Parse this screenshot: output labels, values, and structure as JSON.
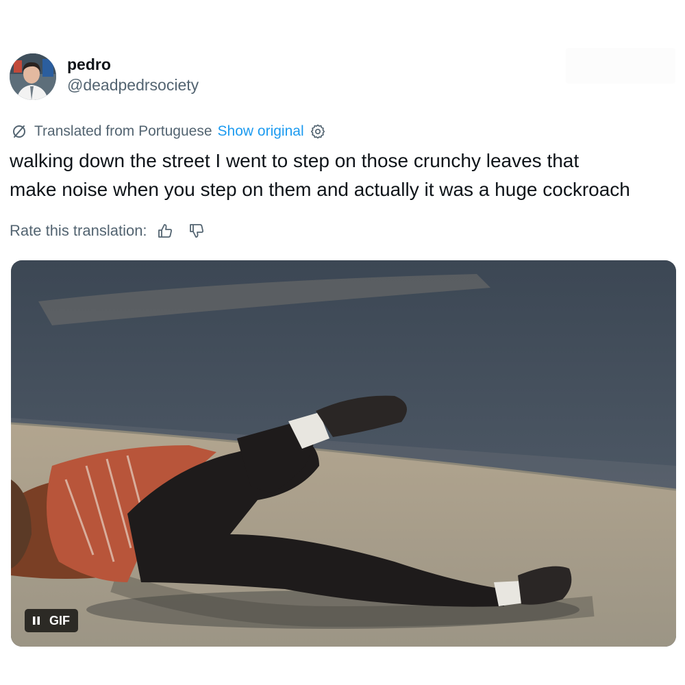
{
  "author": {
    "display_name": "pedro",
    "handle": "@deadpedrsociety",
    "avatar_icon": "profile-photo"
  },
  "translation": {
    "label": "Translated from Portuguese",
    "show_original": "Show original",
    "icon": "translate-icon",
    "settings_icon": "gear-icon"
  },
  "tweet": {
    "text": "walking down the street I went to step on those crunchy leaves that\nmake noise when you step on them and actually it was a huge cockroach"
  },
  "rate": {
    "label": "Rate this translation:",
    "thumbs_up_icon": "thumbs-up-icon",
    "thumbs_down_icon": "thumbs-down-icon"
  },
  "media": {
    "badge_label": "GIF",
    "pause_icon": "pause-icon"
  },
  "colors": {
    "link": "#1d9bf0",
    "secondary_text": "#536471",
    "primary_text": "#0f1419"
  }
}
